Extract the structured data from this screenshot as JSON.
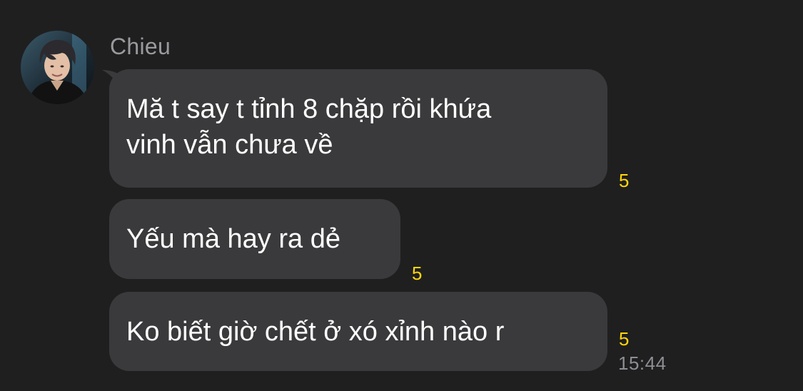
{
  "sender": {
    "name": "Chieu",
    "avatar_icon": "profile-photo"
  },
  "messages": [
    {
      "lines": [
        "Mă t say t tỉnh 8 chặp rồi khứa",
        "vinh vẫn chưa về"
      ],
      "read_count": "5"
    },
    {
      "text": "Yếu mà hay ra dẻ",
      "read_count": "5"
    },
    {
      "text": "Ko biết giờ chết ở xó xỉnh nào r",
      "read_count": "5"
    }
  ],
  "timestamp": "15:44",
  "colors": {
    "background": "#1f1f20",
    "bubble": "#3a3a3c",
    "message_text": "#ffffff",
    "read_count": "#ffd60a",
    "secondary_text": "#8e8e93"
  }
}
